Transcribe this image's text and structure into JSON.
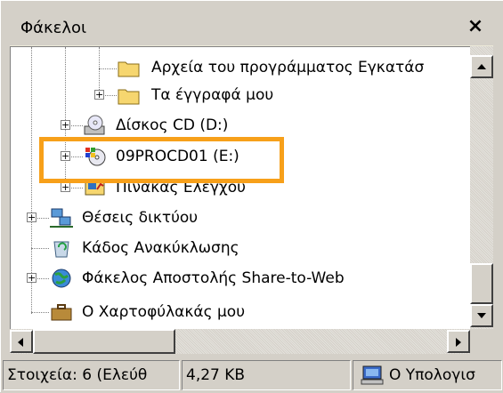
{
  "pane": {
    "title": "Φάκελοι",
    "close_label": "×"
  },
  "tree": {
    "items": [
      {
        "label": "Αρχεία του προγράμματος Εγκατάσ",
        "icon": "folder-icon"
      },
      {
        "label": "Τα έγγραφά μου",
        "icon": "folder-icon"
      },
      {
        "label": "Δίσκος CD (D:)",
        "icon": "cd-drive-icon"
      },
      {
        "label": "09PROCD01 (E:)",
        "icon": "windows-cd-icon"
      },
      {
        "label": "Πίνακας Ελέγχου",
        "icon": "control-panel-icon"
      },
      {
        "label": "Θέσεις δικτύου",
        "icon": "network-places-icon"
      },
      {
        "label": "Κάδος Ανακύκλωσης",
        "icon": "recycle-bin-icon"
      },
      {
        "label": "Φάκελος Αποστολής Share-to-Web",
        "icon": "web-folder-icon"
      },
      {
        "label": "Ο Χαρτοφύλακάς μου",
        "icon": "briefcase-icon"
      }
    ]
  },
  "status": {
    "items_text": "Στοιχεία: 6 (Ελεύθ",
    "size_text": "4,27 KB",
    "location_text": "Ο Υπολογισ",
    "location_icon": "computer-icon"
  },
  "colors": {
    "highlight": "#f7a01a",
    "face": "#d4d0c8"
  }
}
